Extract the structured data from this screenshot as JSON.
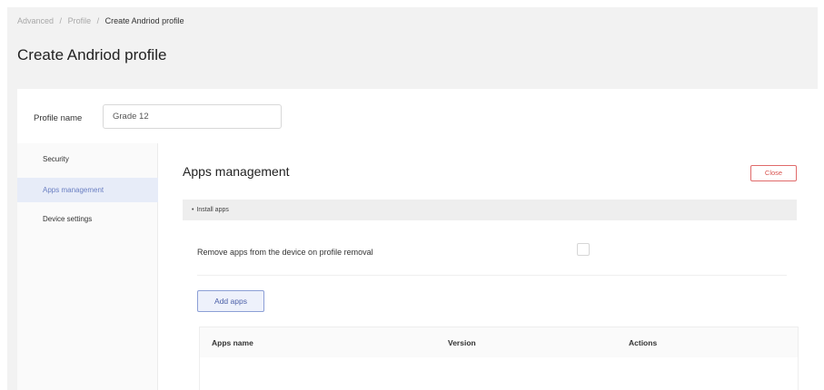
{
  "breadcrumb": {
    "items": [
      "Advanced",
      "Profile",
      "Create Andriod profile"
    ],
    "separator": "/"
  },
  "page_title": "Create Andriod profile",
  "profile": {
    "label": "Profile name",
    "value": "Grade 12"
  },
  "sidebar": {
    "items": [
      {
        "label": "Security",
        "active": false
      },
      {
        "label": "Apps management",
        "active": true
      },
      {
        "label": "Device settings",
        "active": false
      }
    ]
  },
  "apps_management": {
    "title": "Apps management",
    "close_label": "Close",
    "install_header": "Install apps",
    "remove_option_label": "Remove apps from the device on profile removal",
    "remove_option_checked": false,
    "add_apps_label": "Add apps",
    "table": {
      "columns": [
        "Apps name",
        "Version",
        "Actions"
      ],
      "rows": []
    }
  },
  "colors": {
    "page_background": "#f2f2f2",
    "accent": "#6a7fc2",
    "active_item_background": "#e7ecf8",
    "danger": "#d9534f"
  }
}
